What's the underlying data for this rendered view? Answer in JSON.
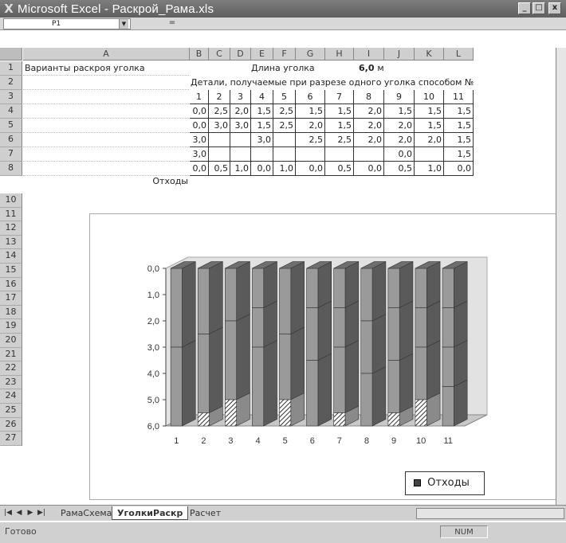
{
  "window": {
    "title": "Microsoft Excel - Раскрой_Рама.xls",
    "logo": "X",
    "minimize": "_",
    "maximize": "□",
    "close": "x"
  },
  "formula_bar": {
    "name_box": "P1",
    "equals": "="
  },
  "columns": [
    "A",
    "B",
    "C",
    "D",
    "E",
    "F",
    "G",
    "H",
    "I",
    "J",
    "K",
    "L"
  ],
  "rows": [
    "1",
    "2",
    "3",
    "4",
    "5",
    "6",
    "7",
    "8",
    "10",
    "11",
    "12",
    "13",
    "14",
    "15",
    "16",
    "17",
    "18",
    "19",
    "20",
    "21",
    "22",
    "23",
    "24",
    "25",
    "26",
    "27"
  ],
  "sheet": {
    "a1": "Варианты раскроя уголка",
    "d1": "Длина уголка",
    "g1_value": "6,0",
    "g1_unit": "м",
    "header_row2": "Детали, получаемые при разрезе одного уголка способом №",
    "method_numbers": [
      "1",
      "2",
      "3",
      "4",
      "5",
      "6",
      "7",
      "8",
      "9",
      "10",
      "11"
    ],
    "parts_rows": [
      [
        "0,0",
        "2,5",
        "2,0",
        "1,5",
        "2,5",
        "1,5",
        "1,5",
        "2,0",
        "1,5",
        "1,5",
        "1,5"
      ],
      [
        "0,0",
        "3,0",
        "3,0",
        "1,5",
        "2,5",
        "2,0",
        "1,5",
        "2,0",
        "2,0",
        "1,5",
        "1,5"
      ],
      [
        "3,0",
        "",
        "",
        "3,0",
        "",
        "2,5",
        "2,5",
        "2,0",
        "2,0",
        "2,0",
        "1,5"
      ],
      [
        "3,0",
        "",
        "",
        "",
        "",
        "",
        "",
        "",
        "0,0",
        "",
        "1,5"
      ]
    ],
    "waste_label": "Отходы",
    "waste_values": [
      "0,0",
      "0,5",
      "1,0",
      "0,0",
      "1,0",
      "0,0",
      "0,5",
      "0,0",
      "0,5",
      "1,0",
      "0,0"
    ]
  },
  "chart_data": {
    "type": "bar",
    "subtype": "3d-stacked-column",
    "categories": [
      "1",
      "2",
      "3",
      "4",
      "5",
      "6",
      "7",
      "8",
      "9",
      "10",
      "11"
    ],
    "series": [
      {
        "name": "",
        "values": [
          0.0,
          2.5,
          2.0,
          1.5,
          2.5,
          1.5,
          1.5,
          2.0,
          1.5,
          1.5,
          1.5
        ]
      },
      {
        "name": "",
        "values": [
          0.0,
          3.0,
          3.0,
          1.5,
          2.5,
          2.0,
          1.5,
          2.0,
          2.0,
          1.5,
          1.5
        ]
      },
      {
        "name": "",
        "values": [
          3.0,
          0.0,
          0.0,
          3.0,
          0.0,
          2.5,
          2.5,
          2.0,
          2.0,
          2.0,
          1.5
        ]
      },
      {
        "name": "",
        "values": [
          3.0,
          0.0,
          0.0,
          0.0,
          0.0,
          0.0,
          0.0,
          0.0,
          0.0,
          0.0,
          1.5
        ]
      },
      {
        "name": "Отходы",
        "values": [
          0.0,
          0.5,
          1.0,
          0.0,
          1.0,
          0.0,
          0.5,
          0.0,
          0.5,
          1.0,
          0.0
        ]
      }
    ],
    "y_tick_labels": [
      "0,0",
      "1,0",
      "2,0",
      "3,0",
      "4,0",
      "5,0",
      "6,0"
    ],
    "ylim": [
      0,
      6
    ],
    "y_inverted": true,
    "legend": "bottom-right",
    "colors": {
      "face": "#9a9a9a",
      "top": "#6e6e6e",
      "side": "#5a5a5a",
      "segment_gap": "#ffffff",
      "floor": "#c8c8c8"
    }
  },
  "tabs": {
    "nav": [
      "|◀",
      "◀",
      "▶",
      "▶|"
    ],
    "items": [
      "РамаСхема",
      "УголкиРаскр",
      "Расчет"
    ],
    "active": 1
  },
  "status": {
    "ready": "Готово",
    "num": "NUM"
  }
}
